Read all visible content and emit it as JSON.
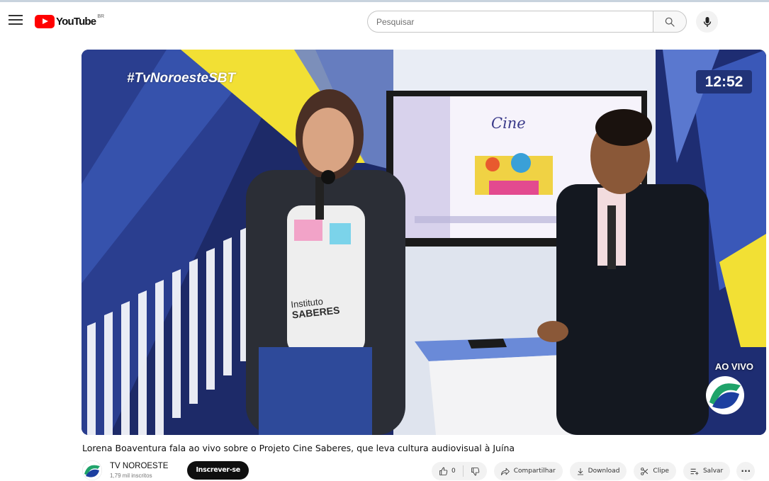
{
  "masthead": {
    "logo_text": "YouTube",
    "logo_country": "BR",
    "search_placeholder": "Pesquisar"
  },
  "player": {
    "hashtag": "#TvNoroesteSBT",
    "clock": "12:52",
    "live_label": "AO VIVO",
    "screen_title": "Cine",
    "shirt_text_1": "Instituto",
    "shirt_text_2": "SABERES"
  },
  "video": {
    "title": "Lorena Boaventura fala ao vivo sobre o Projeto Cine Saberes, que leva cultura audiovisual à Juína"
  },
  "owner": {
    "channel_name": "TV NOROESTE",
    "subscribers": "1,79 mil inscritos",
    "subscribe_label": "Inscrever-se"
  },
  "actions": {
    "like_count": "0",
    "share_label": "Compartilhar",
    "download_label": "Download",
    "clip_label": "Clipe",
    "save_label": "Salvar",
    "more_label": "···"
  },
  "colors": {
    "brand_red": "#ff0000",
    "studio_blue": "#1c2a66",
    "studio_yellow": "#f2e034",
    "clock_bg": "#213377"
  },
  "icons": [
    "menu-icon",
    "youtube-logo-icon",
    "search-icon",
    "mic-icon",
    "like-icon",
    "dislike-icon",
    "share-icon",
    "download-icon",
    "clip-icon",
    "save-icon",
    "more-icon"
  ]
}
